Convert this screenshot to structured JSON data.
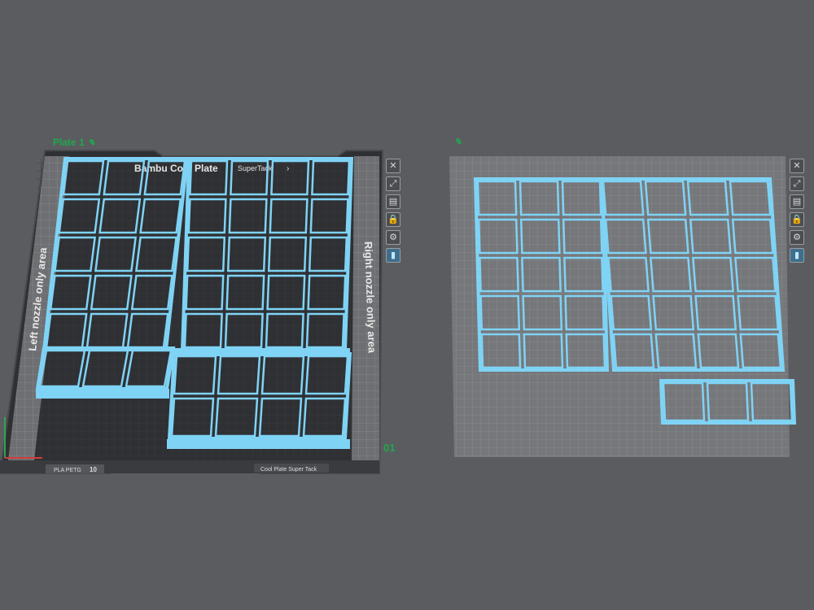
{
  "plate1": {
    "label": "Plate 1",
    "pencil_icon": "pencil-icon",
    "brand_text": "Bambu Cool Plate",
    "brand_sub": "SuperTack",
    "brand_chevron": "›",
    "left_area": "Left nozzle only area",
    "right_area": "Right nozzle only area",
    "filament_tag": "PLA PETG",
    "filament_badge": "10",
    "plate_tag": "Cool Plate Super Tack",
    "number": "01"
  },
  "plate2": {
    "pencil_icon": "pencil-icon"
  },
  "toolbar": [
    {
      "name": "close-plate-icon",
      "glyph": "✕"
    },
    {
      "name": "auto-orient-icon",
      "glyph": "⤢"
    },
    {
      "name": "arrange-icon",
      "glyph": "▤"
    },
    {
      "name": "lock-icon",
      "glyph": "🔒"
    },
    {
      "name": "settings-icon",
      "glyph": "⚙"
    },
    {
      "name": "plate-type-icon",
      "glyph": "▮"
    }
  ],
  "colors": {
    "background": "#5b5c5f",
    "bed_dark": "#2b2c2e",
    "bed_light": "#7a7b7e",
    "part_outline": "#7fd3f5",
    "accent_green": "#1fa84f"
  }
}
